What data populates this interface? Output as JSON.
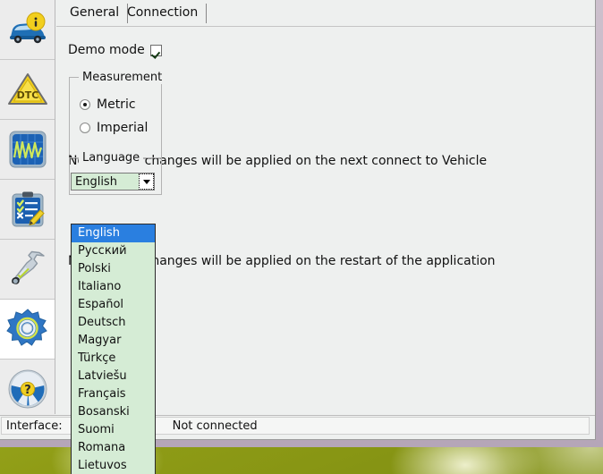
{
  "window": {
    "frame_color": "#c2b4c4",
    "body_bg": "#eef0ef"
  },
  "sidebar": {
    "items": [
      {
        "icon": "car-info-icon",
        "label": "Vehicle Info",
        "selected": false
      },
      {
        "icon": "dtc-warning-triangle-icon",
        "label": "DTC",
        "selected": false
      },
      {
        "icon": "oscilloscope-icon",
        "label": "Live Data",
        "selected": false
      },
      {
        "icon": "checklist-edit-icon",
        "label": "Tests",
        "selected": false
      },
      {
        "icon": "wrench-icon",
        "label": "Service",
        "selected": false
      },
      {
        "icon": "gear-settings-icon",
        "label": "Settings",
        "selected": true
      },
      {
        "icon": "steering-wheel-help-icon",
        "label": "Help",
        "selected": false
      }
    ]
  },
  "tabs": [
    {
      "label": "General",
      "selected": true
    },
    {
      "label": "Connection",
      "selected": false
    }
  ],
  "general": {
    "demo_mode_label": "Demo mode",
    "demo_mode_checked": true,
    "measurement": {
      "title": "Measurement",
      "options": [
        {
          "label": "Metric",
          "selected": true
        },
        {
          "label": "Imperial",
          "selected": false
        }
      ]
    },
    "note_vehicle": "Note: these changes will be applied on the next connect to Vehicle",
    "note_restart": "Note: these changes will be applied on the restart of the application",
    "language": {
      "title": "Language",
      "selected_value": "English",
      "dropdown_open": true,
      "dropdown_bg": "#d5ecd5",
      "highlight_color": "#2a7fe0",
      "options": [
        "English",
        "Русский",
        "Polski",
        "Italiano",
        "Español",
        "Deutsch",
        "Magyar",
        "Türkçe",
        "Latviešu",
        "Français",
        "Bosanski",
        "Suomi",
        "Romana",
        "Lietuvos"
      ]
    }
  },
  "statusbar": {
    "interface_label": "Interface:",
    "led_color": "#a31414",
    "connection_text": "Not connected"
  }
}
